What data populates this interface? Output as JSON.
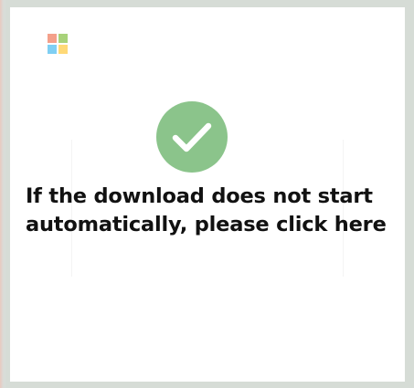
{
  "colors": {
    "logo_red": "#f25022",
    "logo_green": "#7fba00",
    "logo_blue": "#00a4ef",
    "logo_yellow": "#ffb900",
    "success_green": "#8bc48b",
    "check_white": "#ffffff",
    "text": "#111111",
    "background": "#ffffff"
  },
  "logo": {
    "icon": "windows-logo-icon"
  },
  "status": {
    "icon": "checkmark-circle-icon"
  },
  "message": {
    "text": "If the download does not start automatically, please click here"
  }
}
